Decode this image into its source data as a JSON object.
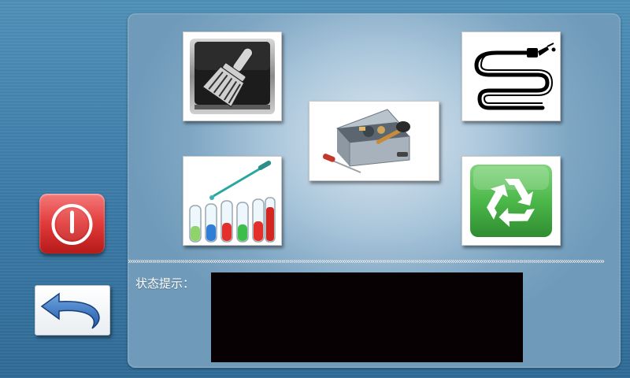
{
  "status": {
    "label": "状态提示：",
    "message": ""
  },
  "divider": {
    "text": "»»»»»»»»»»»»»»»»»»»»»»»»»»»»»»»»»»»»»»»»»»»»»»»»»»»»»»»»»»»»»»»»»»»»»»»»»»»»»»»»»»»»»»»»»»»»»»»»»»»»»»»»»»»»»»»»»»»»»»"
  },
  "icons": {
    "clean": "brush-icon",
    "tools": "toolbox-icon",
    "tubing": "tubing-dropper-icon",
    "reagents": "test-tubes-icon",
    "recycle": "recycle-icon",
    "power": "power-icon",
    "back": "back-arrow-icon"
  },
  "colors": {
    "power_red": "#e23a3a",
    "recycle_green": "#4cb84a",
    "status_box": "#070103"
  }
}
